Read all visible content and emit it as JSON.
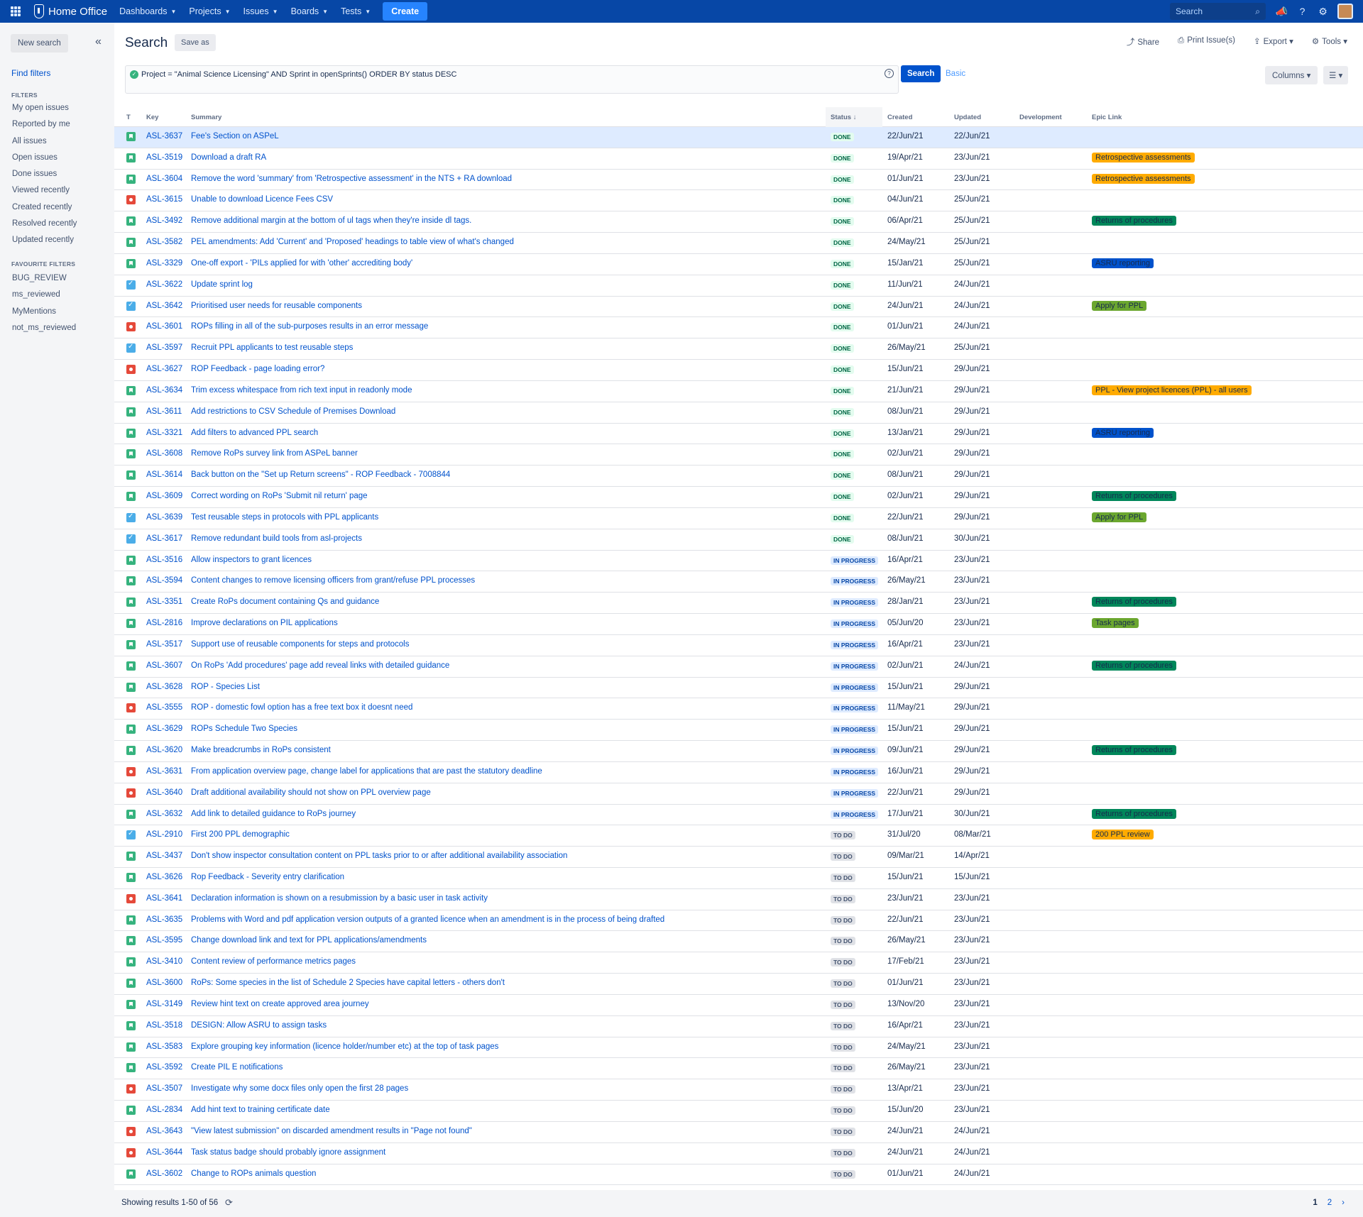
{
  "nav": {
    "brand": "Home Office",
    "items": [
      "Dashboards",
      "Projects",
      "Issues",
      "Boards",
      "Tests"
    ],
    "create": "Create",
    "search_placeholder": "Search"
  },
  "sidebar": {
    "new_search": "New search",
    "find_filters": "Find filters",
    "filters_heading": "FILTERS",
    "filters": [
      "My open issues",
      "Reported by me",
      "All issues",
      "Open issues",
      "Done issues",
      "Viewed recently",
      "Created recently",
      "Resolved recently",
      "Updated recently"
    ],
    "favourites_heading": "FAVOURITE FILTERS",
    "favourites": [
      "BUG_REVIEW",
      "ms_reviewed",
      "MyMentions",
      "not_ms_reviewed"
    ]
  },
  "header": {
    "title": "Search",
    "save_as": "Save as",
    "share": "Share",
    "print": "Print Issue(s)",
    "export": "Export",
    "tools": "Tools"
  },
  "query": {
    "jql": "Project = \"Animal Science Licensing\"  AND Sprint in openSprints() ORDER BY status DESC",
    "search_button": "Search",
    "basic": "Basic",
    "columns_button": "Columns"
  },
  "table": {
    "headers": {
      "t": "T",
      "key": "Key",
      "summary": "Summary",
      "status": "Status",
      "created": "Created",
      "updated": "Updated",
      "development": "Development",
      "epic": "Epic Link"
    },
    "rows": [
      {
        "type": "story",
        "key": "ASL-3637",
        "summary": "Fee's Section on ASPeL",
        "status": "DONE",
        "created": "22/Jun/21",
        "updated": "22/Jun/21",
        "epic": "",
        "epic_color": ""
      },
      {
        "type": "story",
        "key": "ASL-3519",
        "summary": "Download a draft RA",
        "status": "DONE",
        "created": "19/Apr/21",
        "updated": "23/Jun/21",
        "epic": "Retrospective assessments",
        "epic_color": "orange"
      },
      {
        "type": "story",
        "key": "ASL-3604",
        "summary": "Remove the word 'summary' from 'Retrospective assessment' in the NTS + RA download",
        "status": "DONE",
        "created": "01/Jun/21",
        "updated": "23/Jun/21",
        "epic": "Retrospective assessments",
        "epic_color": "orange"
      },
      {
        "type": "bug",
        "key": "ASL-3615",
        "summary": "Unable to download Licence Fees CSV",
        "status": "DONE",
        "created": "04/Jun/21",
        "updated": "25/Jun/21",
        "epic": "",
        "epic_color": ""
      },
      {
        "type": "story",
        "key": "ASL-3492",
        "summary": "Remove additional margin at the bottom of ul tags when they're inside dl tags.",
        "status": "DONE",
        "created": "06/Apr/21",
        "updated": "25/Jun/21",
        "epic": "Returns of procedures",
        "epic_color": "green"
      },
      {
        "type": "story",
        "key": "ASL-3582",
        "summary": "PEL amendments: Add 'Current' and 'Proposed' headings to table view of what's changed",
        "status": "DONE",
        "created": "24/May/21",
        "updated": "25/Jun/21",
        "epic": "",
        "epic_color": ""
      },
      {
        "type": "story",
        "key": "ASL-3329",
        "summary": "One-off export - 'PILs applied for with 'other' accrediting body'",
        "status": "DONE",
        "created": "15/Jan/21",
        "updated": "25/Jun/21",
        "epic": "ASRU reporting",
        "epic_color": "blue"
      },
      {
        "type": "task",
        "key": "ASL-3622",
        "summary": "Update sprint log",
        "status": "DONE",
        "created": "11/Jun/21",
        "updated": "24/Jun/21",
        "epic": "",
        "epic_color": ""
      },
      {
        "type": "task",
        "key": "ASL-3642",
        "summary": "Prioritised user needs for reusable components",
        "status": "DONE",
        "created": "24/Jun/21",
        "updated": "24/Jun/21",
        "epic": "Apply for PPL",
        "epic_color": "lime"
      },
      {
        "type": "bug",
        "key": "ASL-3601",
        "summary": "ROPs filling in all of the sub-purposes results in an error message",
        "status": "DONE",
        "created": "01/Jun/21",
        "updated": "24/Jun/21",
        "epic": "",
        "epic_color": ""
      },
      {
        "type": "task",
        "key": "ASL-3597",
        "summary": "Recruit PPL applicants to test reusable steps",
        "status": "DONE",
        "created": "26/May/21",
        "updated": "25/Jun/21",
        "epic": "",
        "epic_color": ""
      },
      {
        "type": "bug",
        "key": "ASL-3627",
        "summary": "ROP Feedback - page loading error?",
        "status": "DONE",
        "created": "15/Jun/21",
        "updated": "29/Jun/21",
        "epic": "",
        "epic_color": ""
      },
      {
        "type": "story",
        "key": "ASL-3634",
        "summary": "Trim excess whitespace from rich text input in readonly mode",
        "status": "DONE",
        "created": "21/Jun/21",
        "updated": "29/Jun/21",
        "epic": "PPL - View project licences (PPL) - all users",
        "epic_color": "orange"
      },
      {
        "type": "story",
        "key": "ASL-3611",
        "summary": "Add restrictions to CSV Schedule of Premises Download",
        "status": "DONE",
        "created": "08/Jun/21",
        "updated": "29/Jun/21",
        "epic": "",
        "epic_color": ""
      },
      {
        "type": "story",
        "key": "ASL-3321",
        "summary": "Add filters to advanced PPL search",
        "status": "DONE",
        "created": "13/Jan/21",
        "updated": "29/Jun/21",
        "epic": "ASRU reporting",
        "epic_color": "blue"
      },
      {
        "type": "story",
        "key": "ASL-3608",
        "summary": "Remove RoPs survey link from ASPeL banner",
        "status": "DONE",
        "created": "02/Jun/21",
        "updated": "29/Jun/21",
        "epic": "",
        "epic_color": ""
      },
      {
        "type": "story",
        "key": "ASL-3614",
        "summary": "Back button on the \"Set up Return screens\" - ROP Feedback - 7008844",
        "status": "DONE",
        "created": "08/Jun/21",
        "updated": "29/Jun/21",
        "epic": "",
        "epic_color": ""
      },
      {
        "type": "story",
        "key": "ASL-3609",
        "summary": "Correct wording on RoPs 'Submit nil return' page",
        "status": "DONE",
        "created": "02/Jun/21",
        "updated": "29/Jun/21",
        "epic": "Returns of procedures",
        "epic_color": "green"
      },
      {
        "type": "task",
        "key": "ASL-3639",
        "summary": "Test reusable steps in protocols with PPL applicants",
        "status": "DONE",
        "created": "22/Jun/21",
        "updated": "29/Jun/21",
        "epic": "Apply for PPL",
        "epic_color": "lime"
      },
      {
        "type": "task",
        "key": "ASL-3617",
        "summary": "Remove redundant build tools from asl-projects",
        "status": "DONE",
        "created": "08/Jun/21",
        "updated": "30/Jun/21",
        "epic": "",
        "epic_color": ""
      },
      {
        "type": "story",
        "key": "ASL-3516",
        "summary": "Allow inspectors to grant licences",
        "status": "IN PROGRESS",
        "created": "16/Apr/21",
        "updated": "23/Jun/21",
        "epic": "",
        "epic_color": ""
      },
      {
        "type": "story",
        "key": "ASL-3594",
        "summary": "Content changes to remove licensing officers from grant/refuse PPL processes",
        "status": "IN PROGRESS",
        "created": "26/May/21",
        "updated": "23/Jun/21",
        "epic": "",
        "epic_color": ""
      },
      {
        "type": "story",
        "key": "ASL-3351",
        "summary": "Create RoPs document containing Qs and guidance",
        "status": "IN PROGRESS",
        "created": "28/Jan/21",
        "updated": "23/Jun/21",
        "epic": "Returns of procedures",
        "epic_color": "green"
      },
      {
        "type": "story",
        "key": "ASL-2816",
        "summary": "Improve declarations on PIL applications",
        "status": "IN PROGRESS",
        "created": "05/Jun/20",
        "updated": "23/Jun/21",
        "epic": "Task pages",
        "epic_color": "lime"
      },
      {
        "type": "story",
        "key": "ASL-3517",
        "summary": "Support use of reusable components for steps and protocols",
        "status": "IN PROGRESS",
        "created": "16/Apr/21",
        "updated": "23/Jun/21",
        "epic": "",
        "epic_color": ""
      },
      {
        "type": "story",
        "key": "ASL-3607",
        "summary": "On RoPs 'Add procedures' page add reveal links with detailed guidance",
        "status": "IN PROGRESS",
        "created": "02/Jun/21",
        "updated": "24/Jun/21",
        "epic": "Returns of procedures",
        "epic_color": "green"
      },
      {
        "type": "story",
        "key": "ASL-3628",
        "summary": "ROP - Species List",
        "status": "IN PROGRESS",
        "created": "15/Jun/21",
        "updated": "29/Jun/21",
        "epic": "",
        "epic_color": ""
      },
      {
        "type": "bug",
        "key": "ASL-3555",
        "summary": "ROP - domestic fowl option has a free text box it doesnt need",
        "status": "IN PROGRESS",
        "created": "11/May/21",
        "updated": "29/Jun/21",
        "epic": "",
        "epic_color": ""
      },
      {
        "type": "story",
        "key": "ASL-3629",
        "summary": "ROPs Schedule Two Species",
        "status": "IN PROGRESS",
        "created": "15/Jun/21",
        "updated": "29/Jun/21",
        "epic": "",
        "epic_color": ""
      },
      {
        "type": "story",
        "key": "ASL-3620",
        "summary": "Make breadcrumbs in RoPs consistent",
        "status": "IN PROGRESS",
        "created": "09/Jun/21",
        "updated": "29/Jun/21",
        "epic": "Returns of procedures",
        "epic_color": "green"
      },
      {
        "type": "bug",
        "key": "ASL-3631",
        "summary": "From application overview page, change label for applications that are past the statutory deadline",
        "status": "IN PROGRESS",
        "created": "16/Jun/21",
        "updated": "29/Jun/21",
        "epic": "",
        "epic_color": ""
      },
      {
        "type": "bug",
        "key": "ASL-3640",
        "summary": "Draft additional availability should not show on PPL overview page",
        "status": "IN PROGRESS",
        "created": "22/Jun/21",
        "updated": "29/Jun/21",
        "epic": "",
        "epic_color": ""
      },
      {
        "type": "story",
        "key": "ASL-3632",
        "summary": "Add link to detailed guidance to RoPs journey",
        "status": "IN PROGRESS",
        "created": "17/Jun/21",
        "updated": "30/Jun/21",
        "epic": "Returns of procedures",
        "epic_color": "green"
      },
      {
        "type": "task",
        "key": "ASL-2910",
        "summary": "First 200 PPL demographic",
        "status": "TO DO",
        "created": "31/Jul/20",
        "updated": "08/Mar/21",
        "epic": "200 PPL review",
        "epic_color": "orange"
      },
      {
        "type": "story",
        "key": "ASL-3437",
        "summary": "Don't show inspector consultation content on PPL tasks prior to or after additional availability association",
        "status": "TO DO",
        "created": "09/Mar/21",
        "updated": "14/Apr/21",
        "epic": "",
        "epic_color": ""
      },
      {
        "type": "story",
        "key": "ASL-3626",
        "summary": "Rop Feedback - Severity entry clarification",
        "status": "TO DO",
        "created": "15/Jun/21",
        "updated": "15/Jun/21",
        "epic": "",
        "epic_color": ""
      },
      {
        "type": "bug",
        "key": "ASL-3641",
        "summary": "Declaration information is shown on a resubmission by a basic user in task activity",
        "status": "TO DO",
        "created": "23/Jun/21",
        "updated": "23/Jun/21",
        "epic": "",
        "epic_color": ""
      },
      {
        "type": "story",
        "key": "ASL-3635",
        "summary": "Problems with Word and pdf application version outputs of a granted licence when an amendment is in the process of being drafted",
        "status": "TO DO",
        "created": "22/Jun/21",
        "updated": "23/Jun/21",
        "epic": "",
        "epic_color": ""
      },
      {
        "type": "story",
        "key": "ASL-3595",
        "summary": "Change download link and text for PPL applications/amendments",
        "status": "TO DO",
        "created": "26/May/21",
        "updated": "23/Jun/21",
        "epic": "",
        "epic_color": ""
      },
      {
        "type": "story",
        "key": "ASL-3410",
        "summary": "Content review of performance metrics pages",
        "status": "TO DO",
        "created": "17/Feb/21",
        "updated": "23/Jun/21",
        "epic": "",
        "epic_color": ""
      },
      {
        "type": "story",
        "key": "ASL-3600",
        "summary": "RoPs: Some species in the list of Schedule 2 Species have capital letters - others don't",
        "status": "TO DO",
        "created": "01/Jun/21",
        "updated": "23/Jun/21",
        "epic": "",
        "epic_color": ""
      },
      {
        "type": "story",
        "key": "ASL-3149",
        "summary": "Review hint text on create approved area journey",
        "status": "TO DO",
        "created": "13/Nov/20",
        "updated": "23/Jun/21",
        "epic": "",
        "epic_color": ""
      },
      {
        "type": "story",
        "key": "ASL-3518",
        "summary": "DESIGN: Allow ASRU to assign tasks",
        "status": "TO DO",
        "created": "16/Apr/21",
        "updated": "23/Jun/21",
        "epic": "",
        "epic_color": ""
      },
      {
        "type": "story",
        "key": "ASL-3583",
        "summary": "Explore grouping key information (licence holder/number etc) at the top of task pages",
        "status": "TO DO",
        "created": "24/May/21",
        "updated": "23/Jun/21",
        "epic": "",
        "epic_color": ""
      },
      {
        "type": "story",
        "key": "ASL-3592",
        "summary": "Create PIL E notifications",
        "status": "TO DO",
        "created": "26/May/21",
        "updated": "23/Jun/21",
        "epic": "",
        "epic_color": ""
      },
      {
        "type": "bug",
        "key": "ASL-3507",
        "summary": "Investigate why some docx files only open the first 28 pages",
        "status": "TO DO",
        "created": "13/Apr/21",
        "updated": "23/Jun/21",
        "epic": "",
        "epic_color": ""
      },
      {
        "type": "story",
        "key": "ASL-2834",
        "summary": "Add hint text to training certificate date",
        "status": "TO DO",
        "created": "15/Jun/20",
        "updated": "23/Jun/21",
        "epic": "",
        "epic_color": ""
      },
      {
        "type": "bug",
        "key": "ASL-3643",
        "summary": "\"View latest submission\" on discarded amendment results in \"Page not found\"",
        "status": "TO DO",
        "created": "24/Jun/21",
        "updated": "24/Jun/21",
        "epic": "",
        "epic_color": ""
      },
      {
        "type": "bug",
        "key": "ASL-3644",
        "summary": "Task status badge should probably ignore assignment",
        "status": "TO DO",
        "created": "24/Jun/21",
        "updated": "24/Jun/21",
        "epic": "",
        "epic_color": ""
      },
      {
        "type": "story",
        "key": "ASL-3602",
        "summary": "Change to ROPs animals question",
        "status": "TO DO",
        "created": "01/Jun/21",
        "updated": "24/Jun/21",
        "epic": "",
        "epic_color": ""
      }
    ]
  },
  "footer": {
    "results": "Showing results 1-50 of 56",
    "pages": [
      "1",
      "2"
    ],
    "next": "›"
  }
}
